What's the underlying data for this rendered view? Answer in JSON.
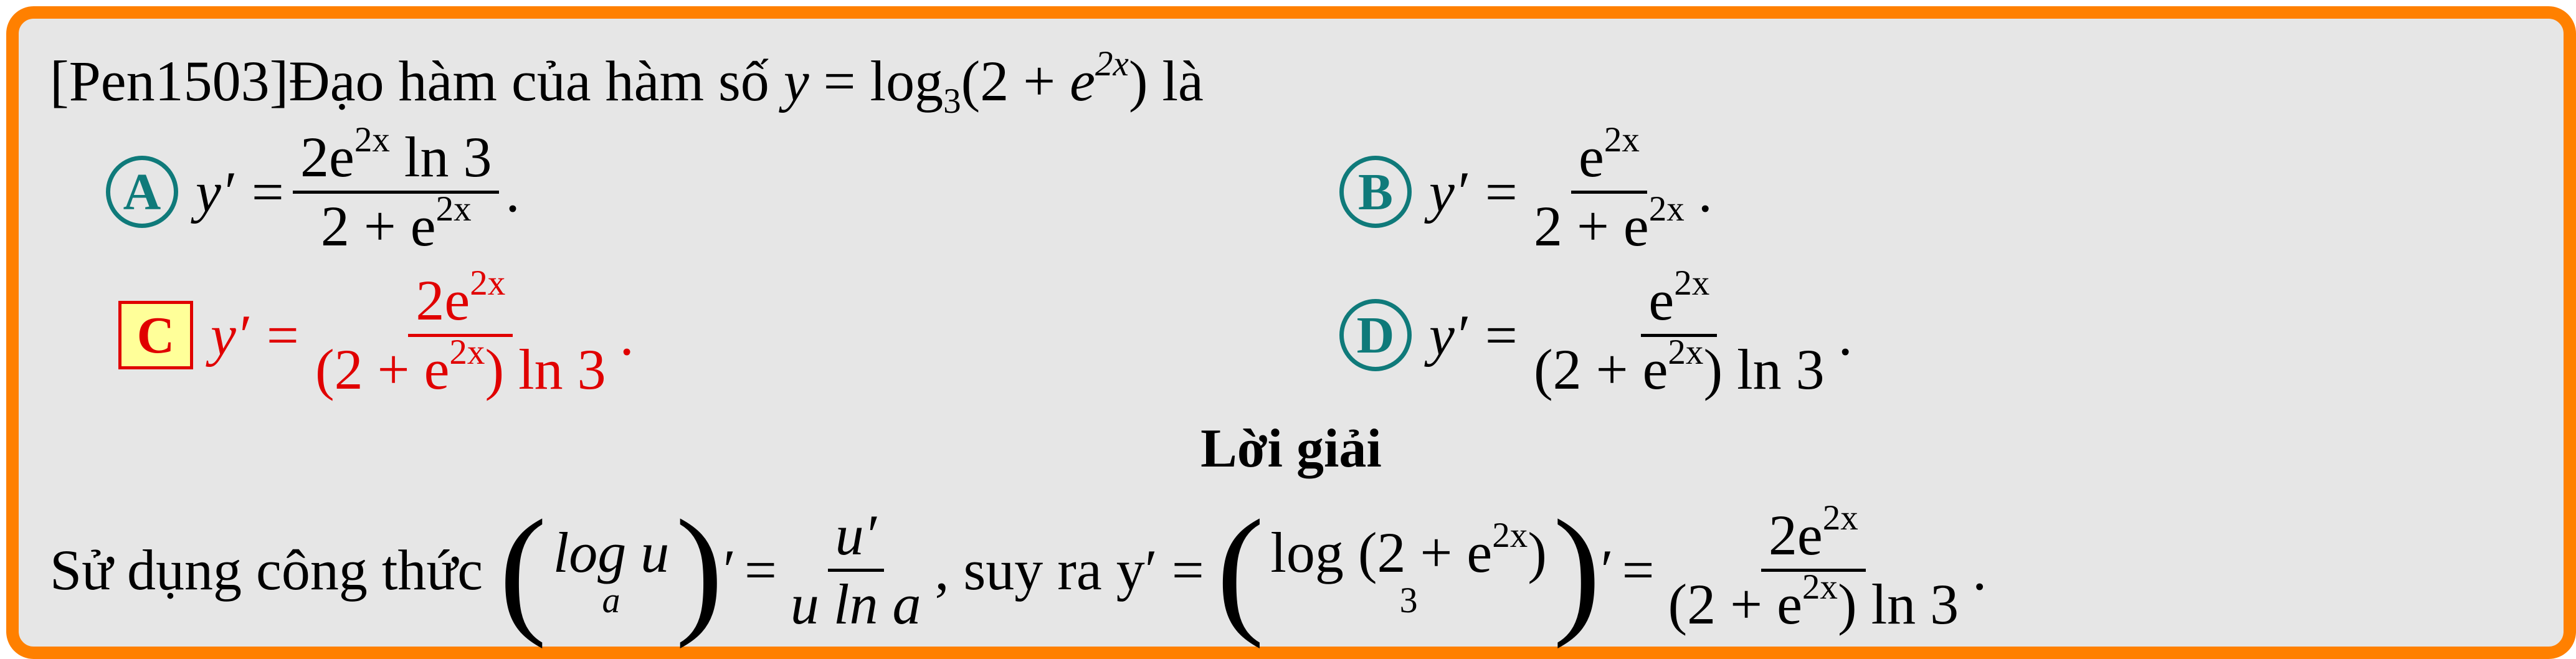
{
  "question": {
    "prefix": "[Pen1503]Đạo hàm của hàm số ",
    "y": "y",
    "eq": " = log",
    "base": "3",
    "open": "(2 + ",
    "e": "e",
    "exp": "2x",
    "close": ")",
    "suffix": " là"
  },
  "options": [
    {
      "letter": "A",
      "lhs": "y′ =",
      "num": "2e",
      "num_exp": "2x",
      "num_tail": " ln 3",
      "den": "2 + e",
      "den_exp": "2x",
      "den_tail": "",
      "end": "."
    },
    {
      "letter": "B",
      "lhs": "y′ =",
      "num": "e",
      "num_exp": "2x",
      "num_tail": "",
      "den": "2 + e",
      "den_exp": "2x",
      "den_tail": "",
      "end": "."
    },
    {
      "letter": "C",
      "lhs": "y′ =",
      "num": "2e",
      "num_exp": "2x",
      "num_tail": "",
      "den": "(2 + e",
      "den_exp": "2x",
      "den_tail": ") ln 3",
      "end": "."
    },
    {
      "letter": "D",
      "lhs": "y′ =",
      "num": "e",
      "num_exp": "2x",
      "num_tail": "",
      "den": "(2 + e",
      "den_exp": "2x",
      "den_tail": ") ln 3",
      "end": "."
    }
  ],
  "colors": {
    "border": "#ff8000",
    "background": "#e6e6e6",
    "teal": "#0f7a7a",
    "answer_red": "#e00000",
    "answer_box_fill": "#ffff99"
  },
  "solution": {
    "heading": "Lời giải",
    "text1": "Sử dụng công thức",
    "log1": "log u",
    "log1_base": "a",
    "prime": "′",
    "eq1": "=",
    "frac1_num": "u′",
    "frac1_den": "u ln a",
    "text2": ", suy ra y′ =",
    "log2": "log (2 + e",
    "log2_exp": "2x",
    "log2_close": ")",
    "log2_base": "3",
    "eq2": "=",
    "frac2_num": "2e",
    "frac2_num_exp": "2x",
    "frac2_den": "(2 + e",
    "frac2_den_exp": "2x",
    "frac2_den_tail": ") ln 3",
    "end": "."
  }
}
